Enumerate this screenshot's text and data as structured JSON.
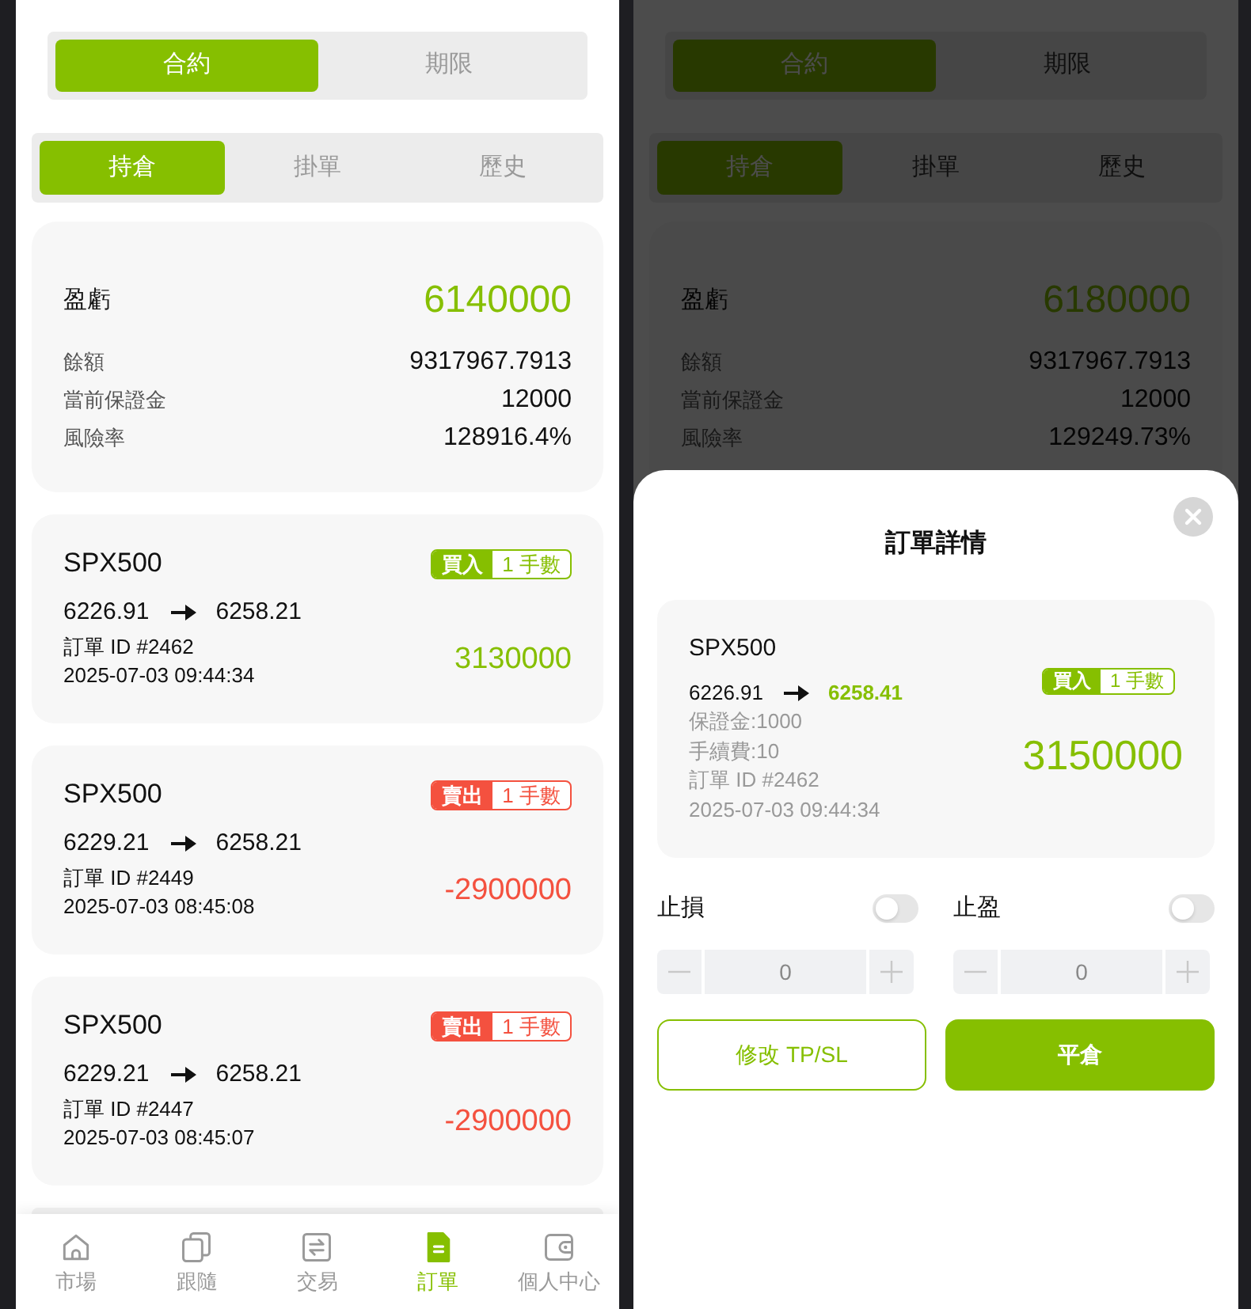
{
  "left_screen": {
    "product_tabs": [
      {
        "label": "合約",
        "selected": true
      },
      {
        "label": "期限",
        "selected": false
      }
    ],
    "order_tabs": [
      {
        "label": "持倉",
        "selected": true
      },
      {
        "label": "掛單",
        "selected": false
      },
      {
        "label": "歷史",
        "selected": false
      }
    ],
    "summary": {
      "pnl_label": "盈虧",
      "pnl_value": "6140000",
      "rows": [
        {
          "label": "餘額",
          "value": "9317967.7913"
        },
        {
          "label": "當前保證金",
          "value": "12000"
        },
        {
          "label": "風險率",
          "value": "128916.4%"
        }
      ]
    },
    "positions": [
      {
        "symbol": "SPX500",
        "kind": "buy",
        "side_label": "買入",
        "lots": "1 手數",
        "open_price": "6226.91",
        "current_price": "6258.21",
        "order_id": "訂單 ID #2462",
        "time": "2025-07-03 09:44:34",
        "pnl": "3130000",
        "color": "#86bf00"
      },
      {
        "symbol": "SPX500",
        "kind": "sell",
        "side_label": "賣出",
        "lots": "1 手數",
        "open_price": "6229.21",
        "current_price": "6258.21",
        "order_id": "訂單 ID #2449",
        "time": "2025-07-03 08:45:08",
        "pnl": "-2900000",
        "color": "#f4513f"
      },
      {
        "symbol": "SPX500",
        "kind": "sell",
        "side_label": "賣出",
        "lots": "1 手數",
        "open_price": "6229.21",
        "current_price": "6258.21",
        "order_id": "訂單 ID #2447",
        "time": "2025-07-03 08:45:07",
        "pnl": "-2900000",
        "color": "#f4513f"
      }
    ],
    "more_below": true,
    "bottom_nav": [
      {
        "label": "市場",
        "selected": false
      },
      {
        "label": "跟隨",
        "selected": false
      },
      {
        "label": "交易",
        "selected": false
      },
      {
        "label": "訂單",
        "selected": true
      },
      {
        "label": "個人中心",
        "selected": false
      }
    ]
  },
  "right_screen": {
    "product_tabs": [
      {
        "label": "合約",
        "selected": true
      },
      {
        "label": "期限",
        "selected": false
      }
    ],
    "order_tabs": [
      {
        "label": "持倉",
        "selected": true
      },
      {
        "label": "掛單",
        "selected": false
      },
      {
        "label": "歷史",
        "selected": false
      }
    ],
    "summary": {
      "pnl_label": "盈虧",
      "pnl_value": "6180000",
      "rows": [
        {
          "label": "餘額",
          "value": "9317967.7913"
        },
        {
          "label": "當前保證金",
          "value": "12000"
        },
        {
          "label": "風險率",
          "value": "129249.73%"
        }
      ]
    },
    "order_sheet": {
      "title": "訂單詳情",
      "order": {
        "symbol": "SPX500",
        "kind": "buy",
        "side_label": "買入",
        "lots": "1 手數",
        "open_price": "6226.91",
        "current_price": "6258.41",
        "margin": "保證金:1000",
        "fee": "手續費:10",
        "order_id": "訂單 ID #2462",
        "time": "2025-07-03 09:44:34",
        "pnl": "3150000",
        "color": "#86bf00"
      },
      "stop_loss": {
        "label": "止損",
        "on": false,
        "value": "0"
      },
      "take_profit": {
        "label": "止盈",
        "on": false,
        "value": "0"
      },
      "actions": [
        {
          "label": "修改 TP/SL",
          "kind": "outline"
        },
        {
          "label": "平倉",
          "kind": "primary"
        }
      ]
    }
  }
}
